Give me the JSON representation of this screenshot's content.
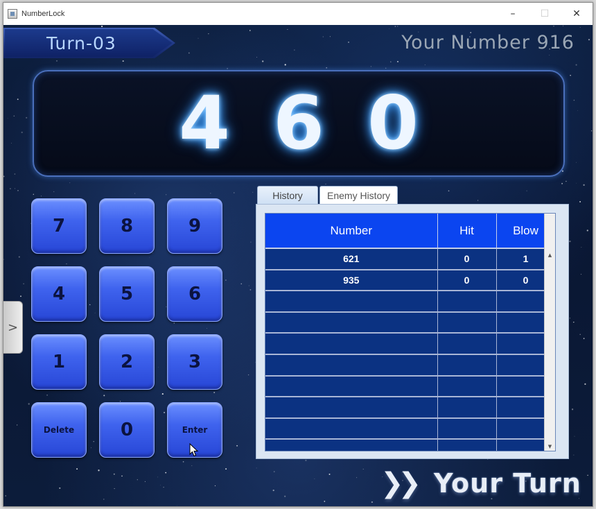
{
  "window": {
    "title": "NumberLock",
    "controls": {
      "minimize": "–",
      "maximize": "☐",
      "close": "✕"
    }
  },
  "game": {
    "turn_label": "Turn-03",
    "your_number_label": "Your Number 916",
    "display_digits": [
      "4",
      "6",
      "0"
    ],
    "keypad": [
      [
        "7",
        "8",
        "9"
      ],
      [
        "4",
        "5",
        "6"
      ],
      [
        "1",
        "2",
        "3"
      ],
      [
        "Delete",
        "0",
        "Enter"
      ]
    ],
    "side_tab": ">",
    "tabs": [
      {
        "label": "History",
        "active": true
      },
      {
        "label": "Enemy History",
        "active": false
      }
    ],
    "history_table": {
      "columns": [
        "Number",
        "Hit",
        "Blow"
      ],
      "rows": [
        [
          "621",
          "0",
          "1"
        ],
        [
          "935",
          "0",
          "0"
        ],
        [
          "",
          "",
          ""
        ],
        [
          "",
          "",
          ""
        ],
        [
          "",
          "",
          ""
        ],
        [
          "",
          "",
          ""
        ],
        [
          "",
          "",
          ""
        ],
        [
          "",
          "",
          ""
        ],
        [
          "",
          "",
          ""
        ],
        [
          "",
          "",
          ""
        ]
      ]
    },
    "status": {
      "arrows": "❯❯",
      "text": "Your Turn"
    }
  },
  "colors": {
    "accent": "#0b45f0",
    "key_face": "#3f63ee",
    "table_cell": "#0b3282",
    "background": "#0a1733"
  },
  "icons": {
    "app": "app-icon",
    "cursor": "mouse-pointer-icon"
  }
}
